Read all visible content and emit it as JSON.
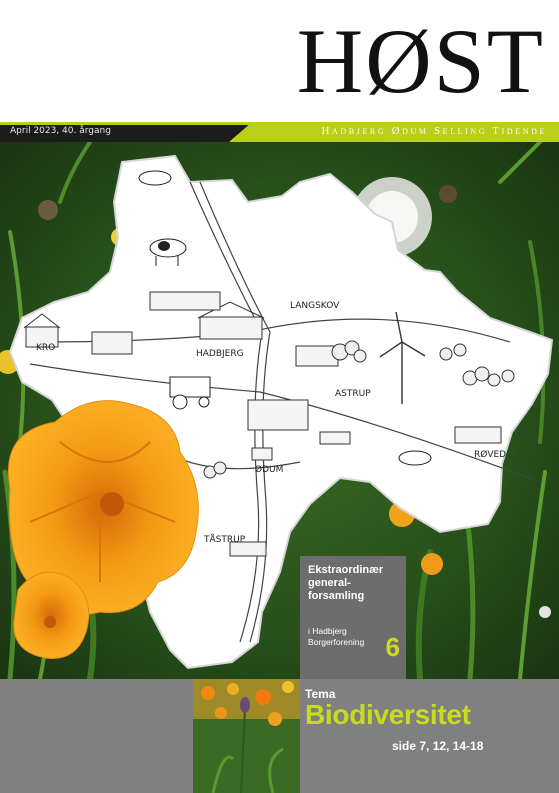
{
  "masthead": {
    "title": "HØST"
  },
  "issue_bar": {
    "date": "April 2023, 40. årgang",
    "tagline": "Hadbjerg Ødum Selling Tidende",
    "accent_color": "#b9cf1c"
  },
  "map": {
    "places": [
      "KRO",
      "HADBJERG",
      "LANGSKOV",
      "ASTRUP",
      "RØVED",
      "ØDUM",
      "TÅSTRUP"
    ]
  },
  "feature": {
    "title": "Ekstraordinær general-forsamling",
    "subtitle": "i Hadbjerg Borgerforening",
    "page": "6"
  },
  "theme": {
    "label": "Tema",
    "title": "Biodiversitet",
    "pages": "side 7, 12, 14-18",
    "accent_color": "#c9dc1c"
  }
}
